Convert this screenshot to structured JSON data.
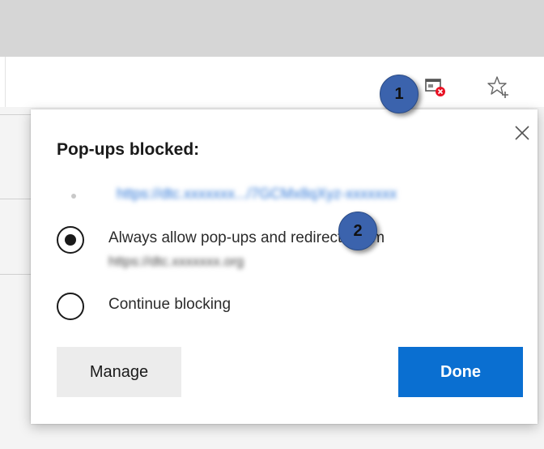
{
  "toolbar": {
    "popup_blocked_icon": "popup-blocked-icon",
    "favorites_icon": "add-favorite-star-icon"
  },
  "panel": {
    "title": "Pop-ups blocked:",
    "blocked_url": "https://dtc.xxxxxxx.../7GCMx8qXyz-xxxxxxx",
    "options": [
      {
        "label": "Always allow pop-ups and redirects from",
        "sublabel": "https://dtc.xxxxxxx.org",
        "selected": true
      },
      {
        "label": "Continue blocking",
        "selected": false
      }
    ],
    "manage_label": "Manage",
    "done_label": "Done"
  },
  "annotations": {
    "badge_1": "1",
    "badge_2": "2"
  },
  "colors": {
    "accent": "#0a6fd1",
    "badge": "#3b63ad",
    "blocked_indicator": "#e81123"
  }
}
